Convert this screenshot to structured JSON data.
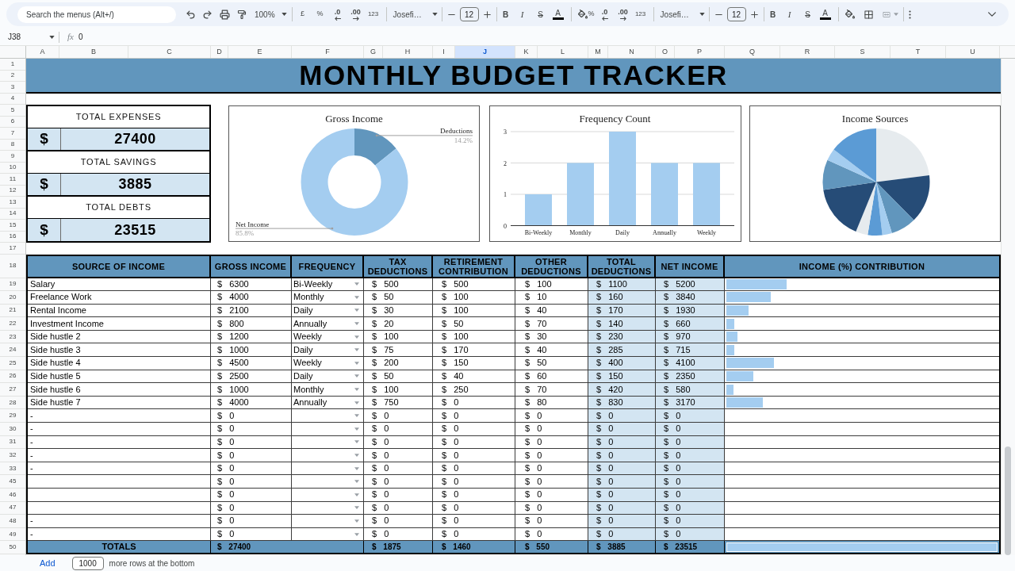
{
  "toolbar": {
    "search": {
      "placeholder": "Search the menus (Alt+/)"
    },
    "zoom": "100%",
    "format_sets": [
      {
        "currency": "£",
        "percent": "%",
        "fewer_decimals": ".0",
        "more_decimals": ".00",
        "number_format": "123",
        "font": "Josefi…",
        "font_size": "12",
        "bold": "B",
        "italic": "I",
        "strikethrough": "S",
        "text_color": "A"
      },
      {
        "percent": "%",
        "fewer_decimals": ".0",
        "more_decimals": ".00",
        "number_format": "123",
        "font": "Josefi…",
        "font_size": "12",
        "bold": "B",
        "italic": "I",
        "strikethrough": "S",
        "text_color": "A"
      }
    ]
  },
  "formula_bar": {
    "cell": "J38",
    "function_symbol": "fx",
    "formula": "0"
  },
  "column_headers": [
    {
      "label": "A",
      "selected": false
    },
    {
      "label": "B",
      "selected": false
    },
    {
      "label": "C",
      "selected": false
    },
    {
      "label": "D",
      "selected": false
    },
    {
      "label": "E",
      "selected": false
    },
    {
      "label": "F",
      "selected": false
    },
    {
      "label": "G",
      "selected": false
    },
    {
      "label": "H",
      "selected": false
    },
    {
      "label": "I",
      "selected": false
    },
    {
      "label": "J",
      "selected": true
    },
    {
      "label": "K",
      "selected": false
    },
    {
      "label": "L",
      "selected": false
    },
    {
      "label": "M",
      "selected": false
    },
    {
      "label": "N",
      "selected": false
    },
    {
      "label": "O",
      "selected": false
    },
    {
      "label": "P",
      "selected": false
    },
    {
      "label": "Q",
      "selected": false
    },
    {
      "label": "R",
      "selected": false
    },
    {
      "label": "S",
      "selected": false
    },
    {
      "label": "T",
      "selected": false
    },
    {
      "label": "U",
      "selected": false
    }
  ],
  "row_headers": [
    "1",
    "2",
    "3",
    "4",
    "5",
    "6",
    "7",
    "8",
    "9",
    "10",
    "11",
    "12",
    "13",
    "14",
    "15",
    "16",
    "17",
    "18",
    "19",
    "20",
    "21",
    "22",
    "23",
    "24",
    "25",
    "26",
    "27",
    "28",
    "29",
    "30",
    "31",
    "32",
    "33",
    "45",
    "46",
    "47",
    "48",
    "49",
    "50"
  ],
  "sheet": {
    "title": "MONTHLY BUDGET TRACKER",
    "summary": [
      {
        "label": "TOTAL EXPENSES",
        "currency": "$",
        "value": "27400"
      },
      {
        "label": "TOTAL SAVINGS",
        "currency": "$",
        "value": "3885"
      },
      {
        "label": "TOTAL DEBTS",
        "currency": "$",
        "value": "23515"
      }
    ],
    "charts": [
      {
        "chart_data": {
          "type": "donut",
          "title": "Gross Income",
          "categories": [
            "Deductions",
            "Net Income"
          ],
          "values": [
            14.2,
            85.8
          ],
          "value_labels": [
            "14.2%",
            "85.8%"
          ]
        }
      },
      {
        "chart_data": {
          "type": "bar",
          "title": "Frequency Count",
          "categories": [
            "Bi-Weekly",
            "Monthly",
            "Daily",
            "Annually",
            "Weekly"
          ],
          "values": [
            1,
            2,
            3,
            2,
            2
          ],
          "ylim": [
            0,
            3
          ],
          "yticks": [
            0,
            1,
            2,
            3
          ]
        }
      },
      {
        "title": "Income Sources"
      }
    ],
    "table": {
      "columns": [
        "SOURCE OF INCOME",
        "GROSS INCOME",
        "FREQUENCY",
        "TAX DEDUCTIONS",
        "RETIREMENT CONTRIBUTION",
        "OTHER DEDUCTIONS",
        "TOTAL DEDUCTIONS",
        "NET INCOME",
        "INCOME (%) CONTRIBUTION"
      ],
      "rows": [
        {
          "source": "Salary",
          "gross": "$ 6300",
          "frequency": "Bi-Weekly",
          "tax": "$ 500",
          "retirement": "$ 500",
          "other": "$ 100",
          "total": "$ 1100",
          "net": "$ 5200",
          "level": 0.221
        },
        {
          "source": "Freelance Work",
          "gross": "$ 4000",
          "frequency": "Monthly",
          "tax": "$ 50",
          "retirement": "$ 100",
          "other": "$ 10",
          "total": "$ 160",
          "net": "$ 3840",
          "level": 0.163
        },
        {
          "source": "Rental Income",
          "gross": "$ 2100",
          "frequency": "Daily",
          "tax": "$ 30",
          "retirement": "$ 100",
          "other": "$ 40",
          "total": "$ 170",
          "net": "$ 1930",
          "level": 0.082
        },
        {
          "source": "Investment Income",
          "gross": "$ 800",
          "frequency": "Annually",
          "tax": "$ 20",
          "retirement": "$ 50",
          "other": "$ 70",
          "total": "$ 140",
          "net": "$ 660",
          "level": 0.028
        },
        {
          "source": "Side hustle 2",
          "gross": "$ 1200",
          "frequency": "Weekly",
          "tax": "$ 100",
          "retirement": "$ 100",
          "other": "$ 30",
          "total": "$ 230",
          "net": "$ 970",
          "level": 0.041
        },
        {
          "source": "Side hustle 3",
          "gross": "$ 1000",
          "frequency": "Daily",
          "tax": "$ 75",
          "retirement": "$ 170",
          "other": "$ 40",
          "total": "$ 285",
          "net": "$ 715",
          "level": 0.03
        },
        {
          "source": "Side hustle 4",
          "gross": "$ 4500",
          "frequency": "Weekly",
          "tax": "$ 200",
          "retirement": "$ 150",
          "other": "$ 50",
          "total": "$ 400",
          "net": "$ 4100",
          "level": 0.174
        },
        {
          "source": "Side hustle 5",
          "gross": "$ 2500",
          "frequency": "Daily",
          "tax": "$ 50",
          "retirement": "$ 40",
          "other": "$ 60",
          "total": "$ 150",
          "net": "$ 2350",
          "level": 0.1
        },
        {
          "source": "Side hustle 6",
          "gross": "$ 1000",
          "frequency": "Monthly",
          "tax": "$ 100",
          "retirement": "$ 250",
          "other": "$ 70",
          "total": "$ 420",
          "net": "$ 580",
          "level": 0.025
        },
        {
          "source": "Side hustle 7",
          "gross": "$ 4000",
          "frequency": "Annually",
          "tax": "$ 750",
          "retirement": "$ 0",
          "other": "$ 80",
          "total": "$ 830",
          "net": "$ 3170",
          "level": 0.135
        },
        {
          "source": "-",
          "gross": "$ 0",
          "tax": "$ 0",
          "retirement": "$ 0",
          "other": "$ 0",
          "total": "$ 0",
          "net": "$ 0"
        },
        {
          "source": "-",
          "gross": "$ 0",
          "tax": "$ 0",
          "retirement": "$ 0",
          "other": "$ 0",
          "total": "$ 0",
          "net": "$ 0"
        },
        {
          "source": "-",
          "gross": "$ 0",
          "tax": "$ 0",
          "retirement": "$ 0",
          "other": "$ 0",
          "total": "$ 0",
          "net": "$ 0"
        },
        {
          "source": "-",
          "gross": "$ 0",
          "tax": "$ 0",
          "retirement": "$ 0",
          "other": "$ 0",
          "total": "$ 0",
          "net": "$ 0"
        },
        {
          "source": "-",
          "gross": "$ 0",
          "tax": "$ 0",
          "retirement": "$ 0",
          "other": "$ 0",
          "total": "$ 0",
          "net": "$ 0"
        },
        {
          "gross": "$ 0",
          "tax": "$ 0",
          "retirement": "$ 0",
          "other": "$ 0",
          "total": "$ 0",
          "net": "$ 0"
        },
        {
          "gross": "$ 0",
          "tax": "$ 0",
          "retirement": "$ 0",
          "other": "$ 0",
          "total": "$ 0",
          "net": "$ 0"
        },
        {
          "gross": "$ 0",
          "tax": "$ 0",
          "retirement": "$ 0",
          "other": "$ 0",
          "total": "$ 0",
          "net": "$ 0"
        },
        {
          "source": "-",
          "gross": "$ 0",
          "tax": "$ 0",
          "retirement": "$ 0",
          "other": "$ 0",
          "total": "$ 0",
          "net": "$ 0"
        },
        {
          "source": "-",
          "gross": "$ 0",
          "tax": "$ 0",
          "retirement": "$ 0",
          "other": "$ 0",
          "total": "$ 0",
          "net": "$ 0"
        }
      ],
      "totals": {
        "label": "TOTALS",
        "gross": "$ 27400",
        "tax": "$ 1875",
        "retirement": "$ 1460",
        "other": "$ 550",
        "total": "$ 3885",
        "net": "$ 23515",
        "level": 1
      }
    }
  },
  "footer": {
    "add_link": "Add",
    "row_count": "1000",
    "label": "more rows at the bottom"
  }
}
